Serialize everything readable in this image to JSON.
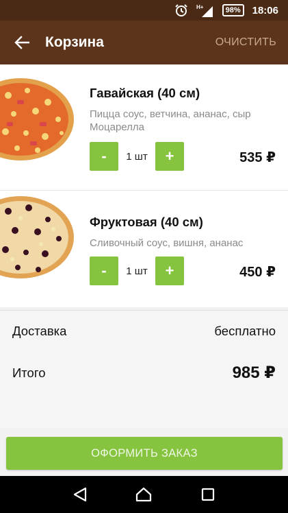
{
  "status_bar": {
    "alarm_icon": "alarm-clock-icon",
    "network_label": "H+",
    "battery": "98%",
    "time": "18:06"
  },
  "app_bar": {
    "title": "Корзина",
    "clear_label": "ОЧИСТИТЬ"
  },
  "cart": {
    "items": [
      {
        "name": "Гавайская (40 см)",
        "description": "Пицца соус, ветчина, ананас, сыр Моцарелла",
        "minus": "-",
        "quantity": "1 шт",
        "plus": "+",
        "price": "535 ₽"
      },
      {
        "name": "Фруктовая (40 см)",
        "description": "Сливочный соус, вишня, ананас",
        "minus": "-",
        "quantity": "1 шт",
        "plus": "+",
        "price": "450 ₽"
      }
    ]
  },
  "summary": {
    "delivery_label": "Доставка",
    "delivery_value": "бесплатно",
    "total_label": "Итого",
    "total_value": "985 ₽"
  },
  "order_button": "ОФОРМИТЬ ЗАКАЗ",
  "colors": {
    "status_bar": "#4a2a15",
    "app_bar": "#5b341b",
    "accent_green": "#86c440",
    "clear_text": "#c9a98e"
  }
}
